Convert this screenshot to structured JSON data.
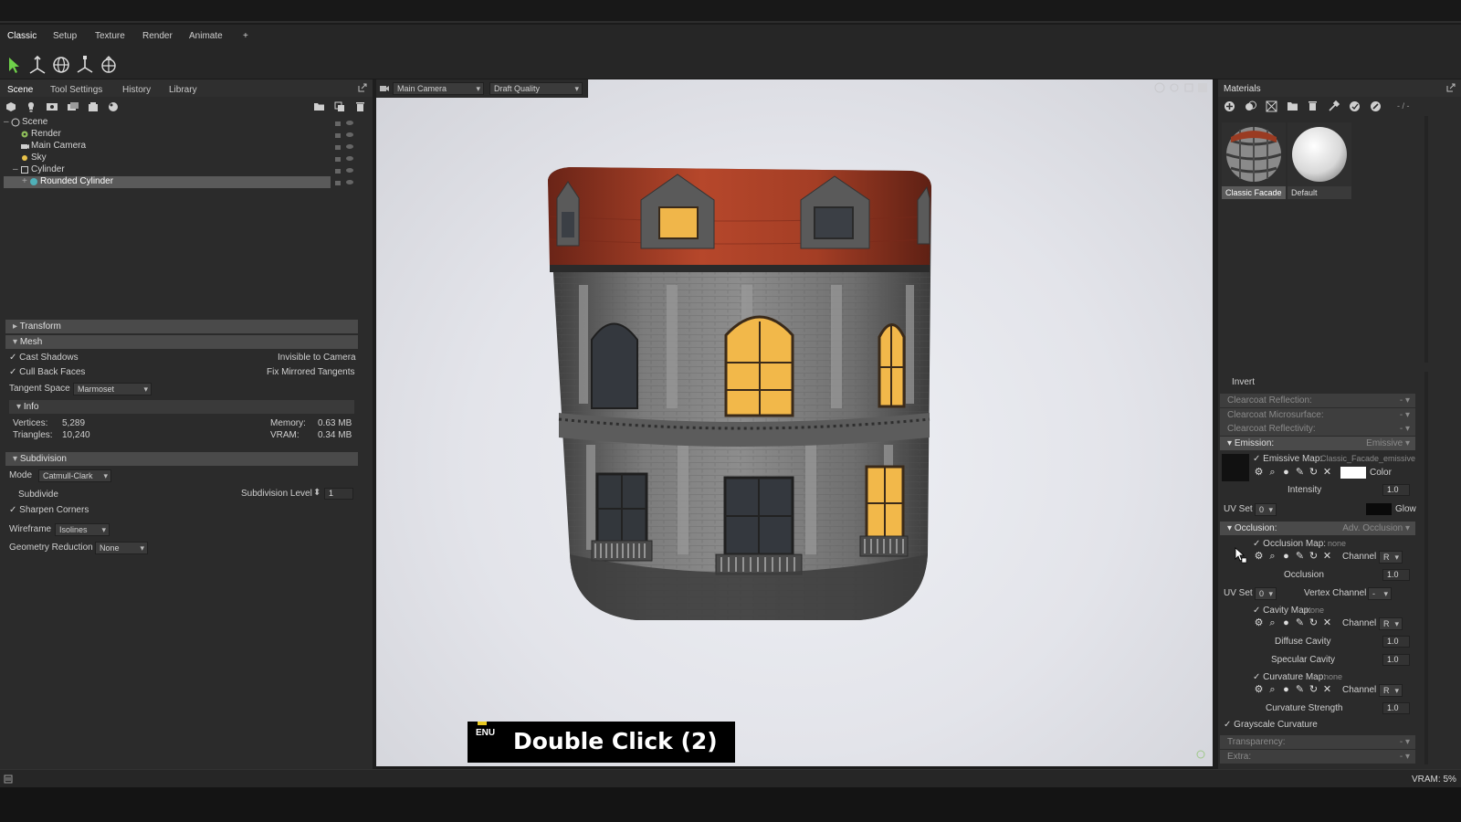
{
  "menu": {
    "items": [
      "Classic",
      "Setup",
      "Texture",
      "Render",
      "Animate",
      "+"
    ]
  },
  "scene_panel": {
    "tabs": [
      "Scene",
      "Tool Settings",
      "History",
      "Library"
    ],
    "tree": [
      {
        "label": "Scene",
        "depth": 0
      },
      {
        "label": "Render",
        "depth": 1
      },
      {
        "label": "Main Camera",
        "depth": 1
      },
      {
        "label": "Sky",
        "depth": 1
      },
      {
        "label": "Cylinder",
        "depth": 1
      },
      {
        "label": "Rounded Cylinder",
        "depth": 2,
        "selected": true
      }
    ]
  },
  "properties": {
    "transform_header": "Transform",
    "mesh_header": "Mesh",
    "cast_shadows": "Cast Shadows",
    "invisible_to_camera": "Invisible to Camera",
    "cull_back_faces": "Cull Back Faces",
    "fix_mirrored_tangents": "Fix Mirrored Tangents",
    "tangent_space_label": "Tangent Space",
    "tangent_space_value": "Marmoset",
    "info_header": "Info",
    "vertices_label": "Vertices:",
    "vertices_value": "5,289",
    "triangles_label": "Triangles:",
    "triangles_value": "10,240",
    "memory_label": "Memory:",
    "memory_value": "0.63 MB",
    "vram_label": "VRAM:",
    "vram_value": "0.34 MB",
    "subdivision_header": "Subdivision",
    "mode_label": "Mode",
    "mode_value": "Catmull-Clark",
    "subdivide_label": "Subdivide",
    "subdivision_level_label": "Subdivision Level",
    "subdivision_level_value": "1",
    "sharpen_corners": "Sharpen Corners",
    "wireframe_label": "Wireframe",
    "wireframe_value": "Isolines",
    "geometry_reduction_label": "Geometry Reduction",
    "geometry_reduction_value": "None"
  },
  "viewport": {
    "camera": "Main Camera",
    "quality": "Draft Quality"
  },
  "caption": {
    "lang": "ENU",
    "text": "Double Click (2)"
  },
  "materials": {
    "title": "Materials",
    "items": [
      {
        "name": "Classic Facade",
        "selected": true
      },
      {
        "name": "Default",
        "selected": false
      }
    ],
    "invert": "Invert",
    "clearcoat_reflection": "Clearcoat Reflection:",
    "clearcoat_microsurface": "Clearcoat Microsurface:",
    "clearcoat_reflectivity": "Clearcoat Reflectivity:",
    "emission_header": "Emission:",
    "emission_type": "Emissive",
    "emissive_map_label": "Emissive Map:",
    "emissive_map_value": "Classic_Facade_emissive",
    "color_label": "Color",
    "intensity_label": "Intensity",
    "intensity_value": "1.0",
    "uv_set_label": "UV Set",
    "uv_set_value": "0",
    "glow_label": "Glow",
    "occlusion_header": "Occlusion:",
    "occlusion_type": "Adv. Occlusion",
    "occlusion_map_label": "Occlusion Map:",
    "occlusion_map_value": "none",
    "channel_label": "Channel",
    "channel_value": "R",
    "occlusion_label": "Occlusion",
    "occlusion_value": "1.0",
    "uv_set2_label": "UV Set",
    "uv_set2_value": "0",
    "vertex_channel_label": "Vertex Channel",
    "vertex_channel_value": "-",
    "cavity_map_label": "Cavity Map:",
    "cavity_map_value": "none",
    "diffuse_cavity_label": "Diffuse Cavity",
    "diffuse_cavity_value": "1.0",
    "specular_cavity_label": "Specular Cavity",
    "specular_cavity_value": "1.0",
    "curvature_map_label": "Curvature Map:",
    "curvature_map_value": "none",
    "curvature_strength_label": "Curvature Strength",
    "curvature_strength_value": "1.0",
    "grayscale_curvature": "Grayscale Curvature",
    "transparency": "Transparency:",
    "extra": "Extra:",
    "top_right_value": "- / -"
  },
  "status": {
    "vram": "VRAM: 5%"
  }
}
